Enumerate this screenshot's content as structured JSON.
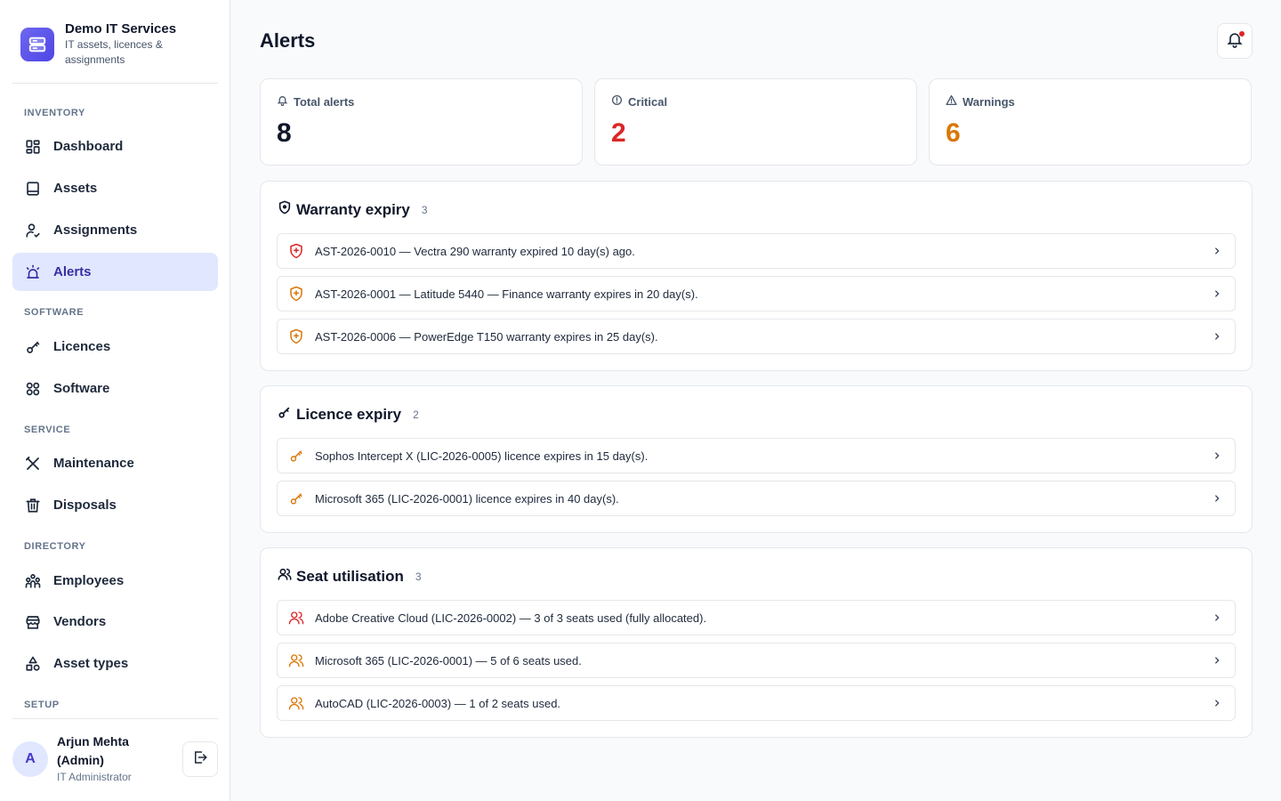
{
  "app": {
    "name": "Demo IT Services",
    "tagline": "IT assets, licences & assignments",
    "brand_color": "#4f46e5"
  },
  "sidebar": {
    "sections": [
      {
        "label": "INVENTORY"
      },
      {
        "label": "SOFTWARE"
      },
      {
        "label": "SERVICE"
      },
      {
        "label": "DIRECTORY"
      },
      {
        "label": "SETUP"
      }
    ],
    "items": [
      {
        "label": "Dashboard",
        "icon": "dashboard-icon"
      },
      {
        "label": "Assets",
        "icon": "laptop-icon"
      },
      {
        "label": "Assignments",
        "icon": "user-assign-icon"
      },
      {
        "label": "Alerts",
        "icon": "alarm-icon",
        "active": true
      },
      {
        "label": "Licences",
        "icon": "key-icon"
      },
      {
        "label": "Software",
        "icon": "apps-icon"
      },
      {
        "label": "Maintenance",
        "icon": "tools-icon"
      },
      {
        "label": "Disposals",
        "icon": "trash-icon"
      },
      {
        "label": "Employees",
        "icon": "users-icon"
      },
      {
        "label": "Vendors",
        "icon": "store-icon"
      },
      {
        "label": "Asset types",
        "icon": "shapes-icon"
      }
    ]
  },
  "user": {
    "initial": "A",
    "name": "Arjun Mehta (Admin)",
    "role": "IT Administrator"
  },
  "page": {
    "title": "Alerts"
  },
  "stats": [
    {
      "label": "Total alerts",
      "value": "8",
      "icon": "bell-icon",
      "color": "#0f172a"
    },
    {
      "label": "Critical",
      "value": "2",
      "icon": "info-circle-icon",
      "color": "#dc2626"
    },
    {
      "label": "Warnings",
      "value": "6",
      "icon": "warning-triangle-icon",
      "color": "#d97706"
    }
  ],
  "colors": {
    "critical": "#dc2626",
    "warning": "#d97706"
  },
  "groups": [
    {
      "title": "Warranty expiry",
      "count": "3",
      "icon": "shield-icon",
      "rows": [
        {
          "text": "AST-2026-0010 — Vectra 290 warranty expired 10 day(s) ago.",
          "severity": "critical",
          "icon": "shield-plus-icon"
        },
        {
          "text": "AST-2026-0001 — Latitude 5440 — Finance warranty expires in 20 day(s).",
          "severity": "warning",
          "icon": "shield-plus-icon"
        },
        {
          "text": "AST-2026-0006 — PowerEdge T150 warranty expires in 25 day(s).",
          "severity": "warning",
          "icon": "shield-plus-icon"
        }
      ]
    },
    {
      "title": "Licence expiry",
      "count": "2",
      "icon": "key-icon",
      "rows": [
        {
          "text": "Sophos Intercept X (LIC-2026-0005) licence expires in 15 day(s).",
          "severity": "warning",
          "icon": "key-icon"
        },
        {
          "text": "Microsoft 365 (LIC-2026-0001) licence expires in 40 day(s).",
          "severity": "warning",
          "icon": "key-icon"
        }
      ]
    },
    {
      "title": "Seat utilisation",
      "count": "3",
      "icon": "users-icon",
      "rows": [
        {
          "text": "Adobe Creative Cloud (LIC-2026-0002) — 3 of 3 seats used (fully allocated).",
          "severity": "critical",
          "icon": "users-icon"
        },
        {
          "text": "Microsoft 365 (LIC-2026-0001) — 5 of 6 seats used.",
          "severity": "warning",
          "icon": "users-icon"
        },
        {
          "text": "AutoCAD (LIC-2026-0003) — 1 of 2 seats used.",
          "severity": "warning",
          "icon": "users-icon"
        }
      ]
    }
  ]
}
